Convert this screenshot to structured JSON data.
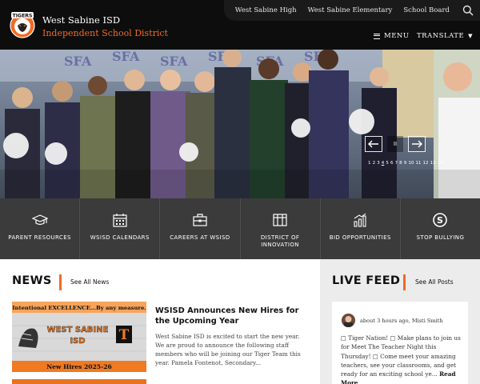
{
  "header": {
    "district_name": "West Sabine ISD",
    "district_subtitle": "Independent School District",
    "logo_text": "TIGERS",
    "top_links": [
      "West Sabine High",
      "West Sabine Elementary",
      "School Board"
    ],
    "menu_label": "MENU",
    "translate_label": "TRANSLATE",
    "search_icon": "search-icon"
  },
  "hero": {
    "pause_symbol": "II",
    "slide_numbers": [
      "1",
      "2",
      "3",
      "4",
      "5",
      "6",
      "7",
      "8",
      "9",
      "10",
      "11",
      "12",
      "13",
      "14"
    ],
    "active_slide": 3
  },
  "quick_links": [
    {
      "label": "PARENT RESOURCES",
      "icon": "graduation-cap-icon"
    },
    {
      "label": "WSISD CALENDARS",
      "icon": "calendar-icon"
    },
    {
      "label": "CAREERS AT WSISD",
      "icon": "briefcase-icon"
    },
    {
      "label": "DISTRICT OF INNOVATION",
      "icon": "building-columns-icon"
    },
    {
      "label": "BID OPPORTUNITIES",
      "icon": "bar-chart-icon"
    },
    {
      "label": "STOP BULLYING",
      "icon": "stop-bullying-icon"
    }
  ],
  "news": {
    "title": "NEWS",
    "see_all": "See All News",
    "article": {
      "image_banner": "Intentional EXCELLENCE...By any measure.",
      "image_title_line1": "WEST SABINE",
      "image_title_line2": "ISD",
      "image_footer": "New Hires 2025-26",
      "headline": "WSISD Announces New Hires for the Upcoming Year",
      "summary": "West Sabine ISD is excited to start the new year. We are proud to announce the following staff members who will be joining our Tiger Team this year. Pamela Fontenot, Secondary..."
    }
  },
  "live_feed": {
    "title": "LIVE FEED",
    "see_all": "See All Posts",
    "post": {
      "meta": "about 3 hours ago, Misti Smith",
      "text": "□ Tiger Nation! □ Make plans to join us for Meet The Teacher Night this Thursday! □ Come meet your amazing teachers, see your classrooms, and get ready for an exciting school ye...",
      "read_more": "Read More"
    }
  },
  "colors": {
    "accent_orange": "#f26a21",
    "header_black": "#0d0d0d",
    "quicklinks_gray": "#3b3b3b",
    "feed_bg": "#ececec"
  }
}
